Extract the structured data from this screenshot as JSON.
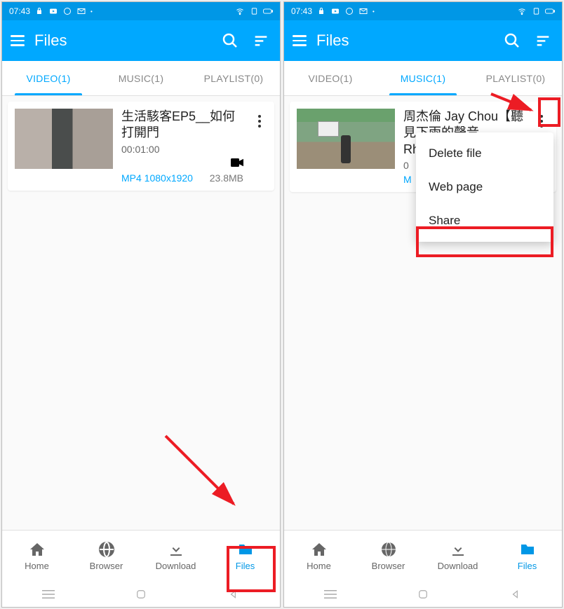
{
  "status": {
    "time": "07:43"
  },
  "header": {
    "title": "Files"
  },
  "left": {
    "tabs": {
      "video": "VIDEO(1)",
      "music": "MUSIC(1)",
      "playlist": "PLAYLIST(0)",
      "active": "video"
    },
    "item": {
      "title": "生活駭客EP5__如何打開門",
      "duration": "00:01:00",
      "format": "MP4 1080x1920",
      "size": "23.8MB"
    }
  },
  "right": {
    "tabs": {
      "video": "VIDEO(1)",
      "music": "MUSIC(1)",
      "playlist": "PLAYLIST(0)",
      "active": "music"
    },
    "item": {
      "title": "周杰倫 Jay Chou【聽見下雨的聲音 Rhythm of…",
      "duration": "0",
      "format_prefix": "M"
    },
    "menu": {
      "delete": "Delete file",
      "web": "Web page",
      "share": "Share"
    }
  },
  "nav": {
    "home": "Home",
    "browser": "Browser",
    "download": "Download",
    "files": "Files"
  }
}
